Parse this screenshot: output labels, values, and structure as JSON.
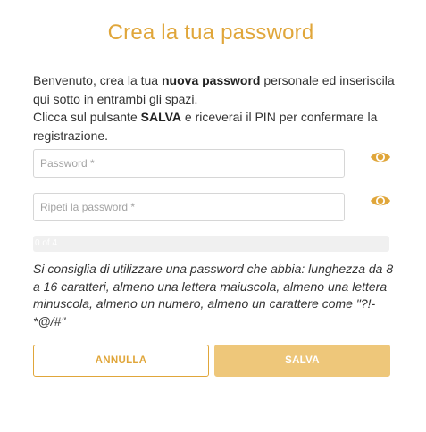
{
  "page": {
    "title": "Crea la tua password"
  },
  "intro": {
    "line1_pre": "Benvenuto, crea la tua ",
    "line1_bold": "nuova password",
    "line1_post": " personale ed inseriscila qui sotto in entrambi gli spazi.",
    "line2_pre": "Clicca sul pulsante ",
    "line2_bold": "SALVA",
    "line2_post": " e riceverai il PIN per confermare la registrazione."
  },
  "form": {
    "password": {
      "placeholder": "Password *",
      "value": "",
      "toggle_icon": "eye-icon"
    },
    "repeat_password": {
      "placeholder": "Ripeti la password *",
      "value": "",
      "toggle_icon": "eye-icon"
    },
    "strength": {
      "label": "0 of 4",
      "level": 0
    }
  },
  "hint": "Si consiglia di utilizzare una password che abbia: lunghezza da 8 a 16 caratteri, almeno una lettera maiuscola, almeno una lettera minuscola, almeno un numero, almeno un carattere come \"?!-*@/#\"",
  "actions": {
    "cancel_label": "ANNULLA",
    "save_label": "SALVA"
  },
  "colors": {
    "accent": "#e0a63a",
    "save_button_bg": "#eec77a",
    "field_border": "#d6d6d6",
    "text": "#333333"
  }
}
